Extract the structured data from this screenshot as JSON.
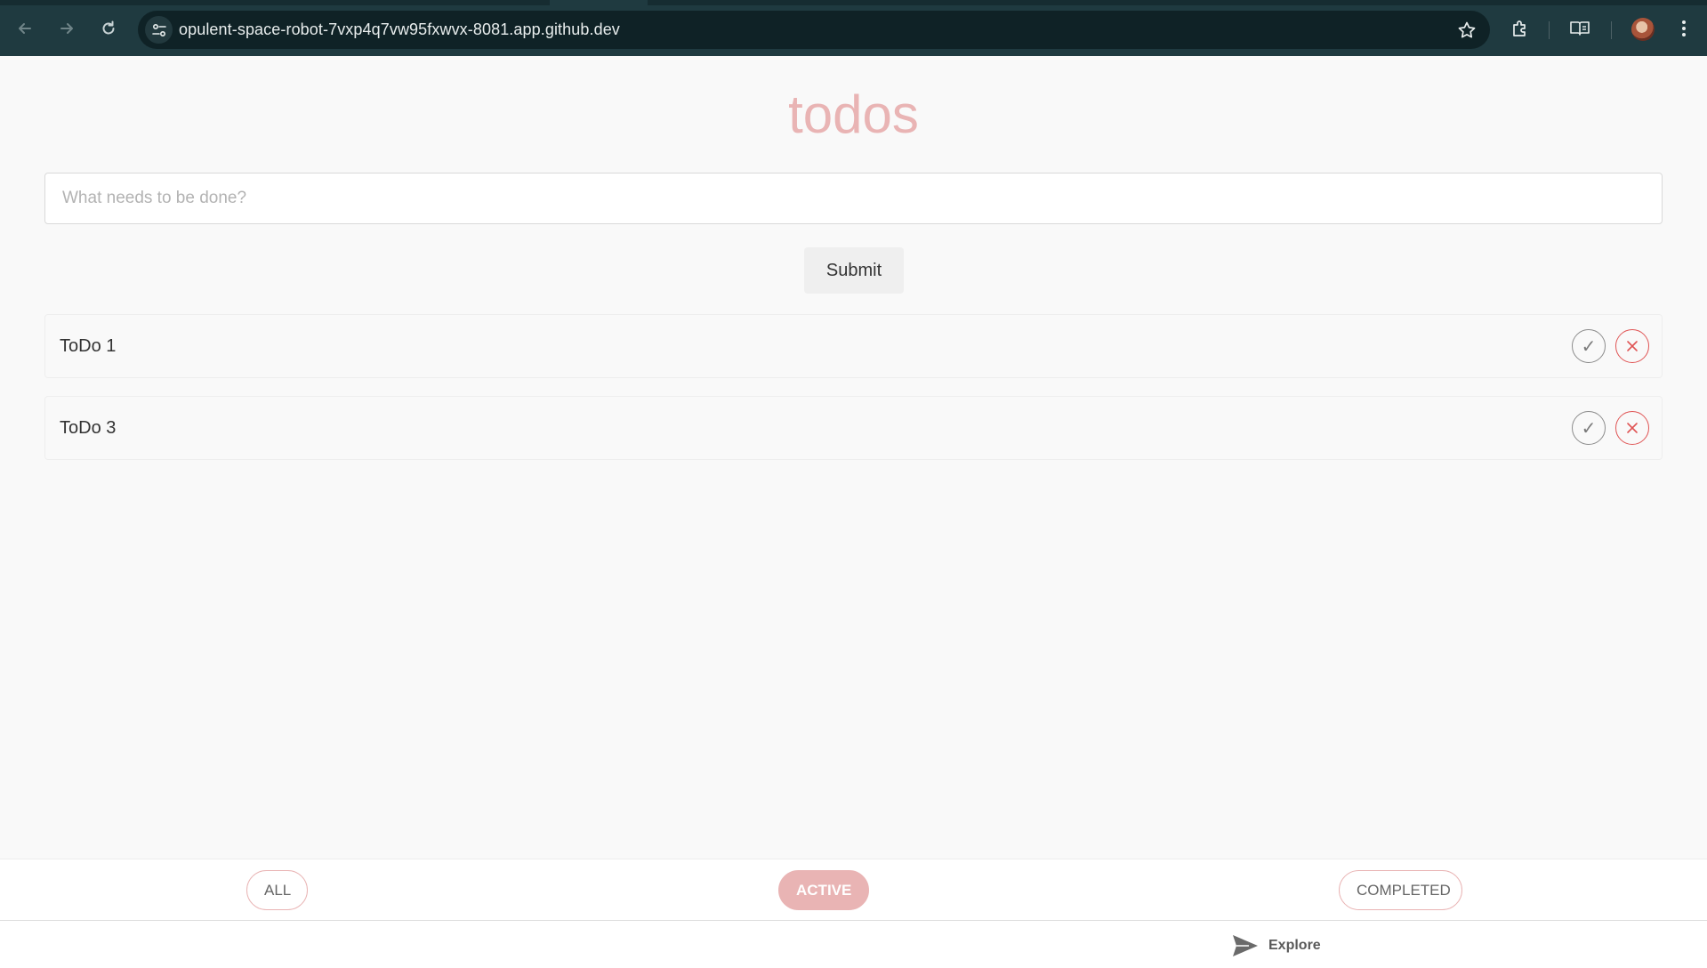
{
  "browser": {
    "url": "opulent-space-robot-7vxp4q7vw95fxwvx-8081.app.github.dev",
    "icons": [
      "back-icon",
      "forward-icon",
      "reload-icon",
      "site-info-icon",
      "bookmark-star-icon",
      "extensions-icon",
      "reading-mode-icon",
      "profile-avatar",
      "more-menu-icon"
    ]
  },
  "app": {
    "title": "todos",
    "new_todo_placeholder": "What needs to be done?",
    "new_todo_value": "",
    "submit_label": "Submit",
    "todos": [
      {
        "text": "ToDo 1",
        "completed": false
      },
      {
        "text": "ToDo 3",
        "completed": false
      }
    ],
    "check_glyph": "✓",
    "accent_color": "#e9b4b4",
    "delete_color": "#e05555"
  },
  "filters": {
    "all_label": "ALL",
    "active_label": "ACTIVE",
    "completed_label": "COMPLETED",
    "selected": "ACTIVE"
  },
  "bottom": {
    "explore_label": "Explore"
  }
}
